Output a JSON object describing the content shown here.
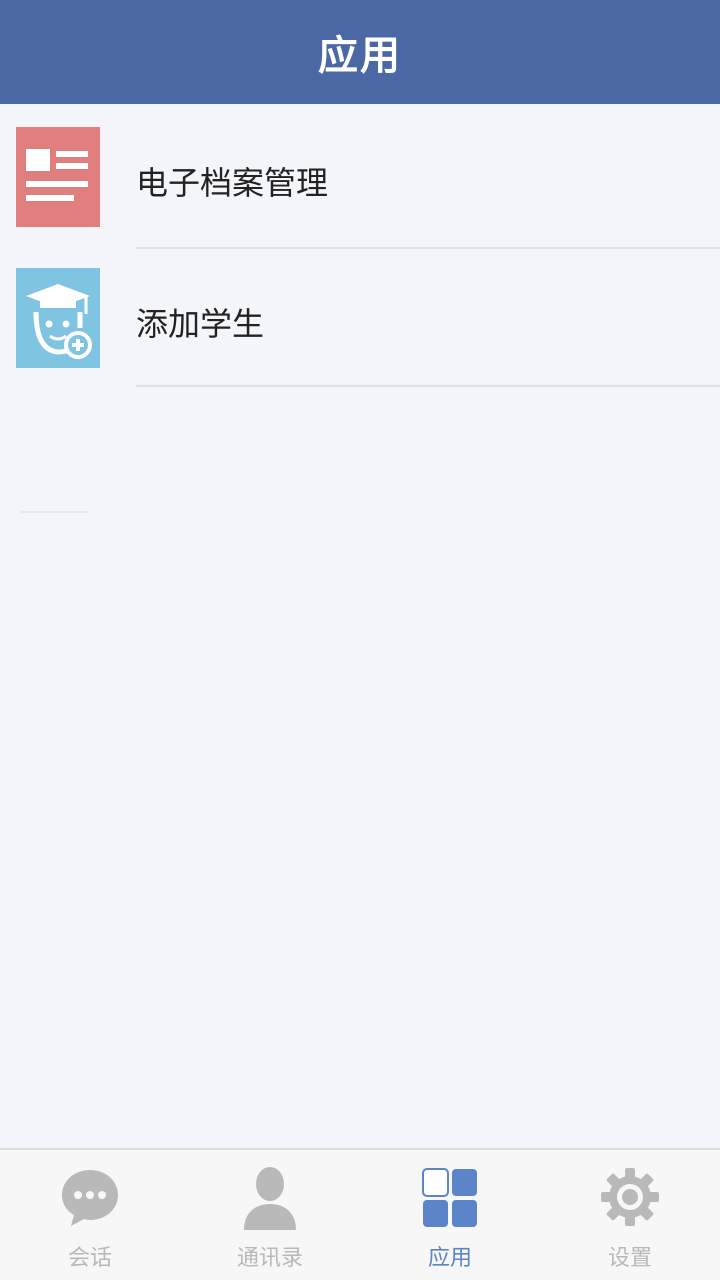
{
  "header": {
    "title": "应用"
  },
  "apps": [
    {
      "label": "电子档案管理",
      "icon": "document-icon",
      "color": "#e07f7d"
    },
    {
      "label": "添加学生",
      "icon": "add-student-icon",
      "color": "#7fc4e0"
    }
  ],
  "tabbar": {
    "active_index": 2,
    "tabs": [
      {
        "label": "会话",
        "icon": "chat-bubble-icon"
      },
      {
        "label": "通讯录",
        "icon": "contacts-person-icon"
      },
      {
        "label": "应用",
        "icon": "apps-grid-icon"
      },
      {
        "label": "设置",
        "icon": "gear-icon"
      }
    ]
  },
  "colors": {
    "header_bg": "#4b68a5",
    "page_bg": "#f4f5fa",
    "tab_active": "#5b84c9",
    "tab_inactive": "#b9b9b9"
  }
}
